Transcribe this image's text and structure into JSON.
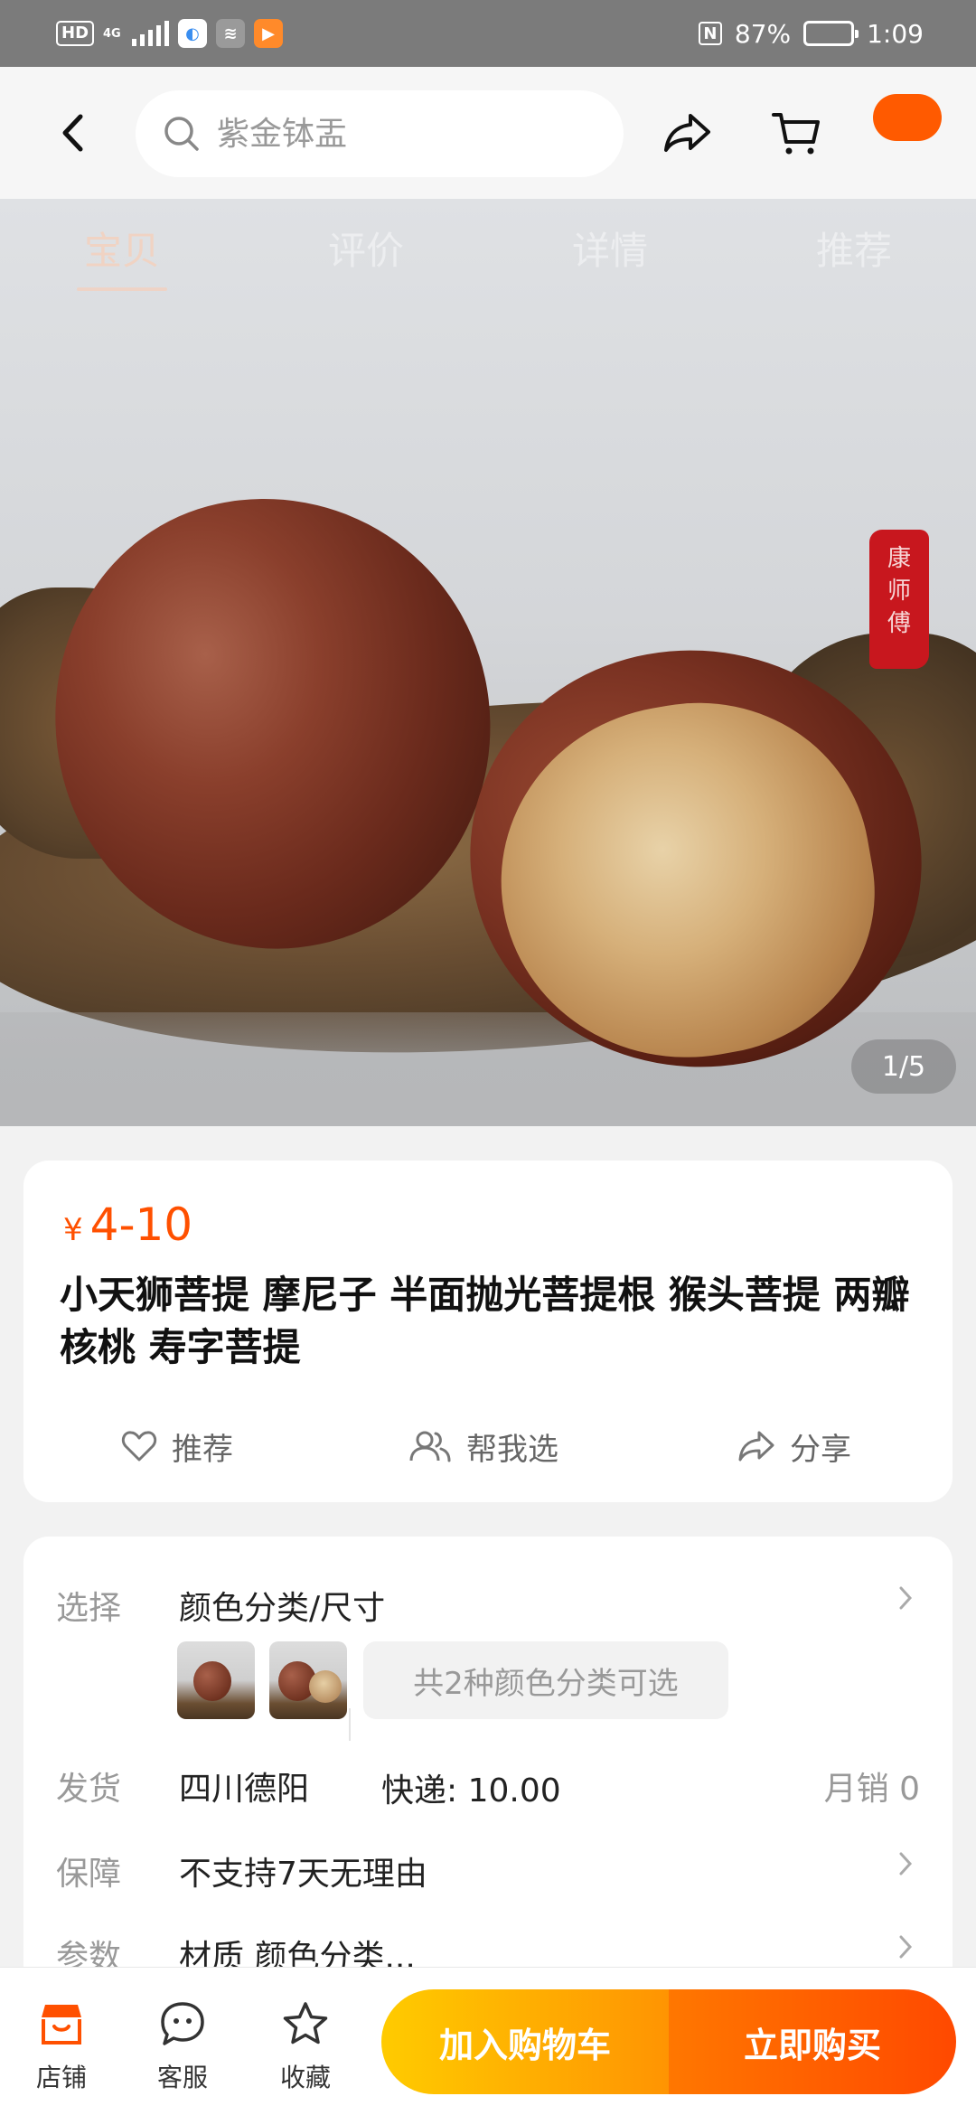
{
  "status_bar": {
    "hd": "HD",
    "network": "4G",
    "battery_text": "87%",
    "time": "1:09",
    "nfc": "N",
    "battery_level": 0.87
  },
  "header": {
    "search_placeholder": "紫金钵盂"
  },
  "gallery": {
    "tabs": [
      "宝贝",
      "评价",
      "详情",
      "推荐"
    ],
    "active_tab": 0,
    "seal_text": [
      "康",
      "师",
      "傅"
    ],
    "counter": "1/5"
  },
  "product": {
    "currency": "¥",
    "price": "4-10",
    "title": "小天狮菩提 摩尼子 半面抛光菩提根 猴头菩提 两瓣核桃 寿字菩提",
    "actions": {
      "recommend": "推荐",
      "help_choose": "帮我选",
      "share": "分享"
    }
  },
  "specs": {
    "select": {
      "label": "选择",
      "value": "颜色分类/尺寸",
      "chip": "共2种颜色分类可选"
    },
    "shipping": {
      "label": "发货",
      "origin": "四川德阳",
      "express": "快递: 10.00",
      "monthly_sales": "月销 0"
    },
    "guarantee": {
      "label": "保障",
      "value": "不支持7天无理由"
    },
    "params": {
      "label": "参数",
      "value": "材质 颜色分类..."
    }
  },
  "bottom_bar": {
    "shop": "店铺",
    "service": "客服",
    "favorite": "收藏",
    "add_to_cart": "加入购物车",
    "buy_now": "立即购买"
  },
  "colors": {
    "accent": "#ff5000",
    "cart_gradient": [
      "#ffcb00",
      "#ff9402"
    ],
    "buy_gradient": [
      "#ff7700",
      "#ff4900"
    ]
  }
}
